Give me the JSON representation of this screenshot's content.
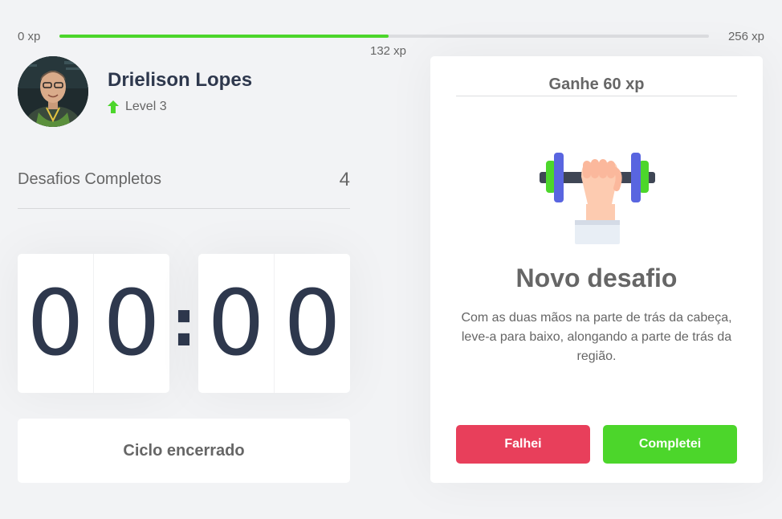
{
  "xp": {
    "min_label": "0 xp",
    "max_label": "256 xp",
    "current_label": "132 xp",
    "progress_fraction": 0.506
  },
  "profile": {
    "name": "Drielison Lopes",
    "level_label": "Level 3"
  },
  "completed": {
    "label": "Desafios Completos",
    "count": "4"
  },
  "countdown": {
    "minute_left": "0",
    "minute_right": "0",
    "separator": ":",
    "second_left": "0",
    "second_right": "0"
  },
  "cycle_button": {
    "label": "Ciclo encerrado"
  },
  "challenge": {
    "header": "Ganhe 60 xp",
    "title": "Novo desafio",
    "description": "Com as duas mãos na parte de trás da cabeça, leve-a para baixo, alongando a parte de trás da região.",
    "icon": "dumbbell-icon",
    "fail_label": "Falhei",
    "done_label": "Completei"
  },
  "colors": {
    "accent_green": "#4cd62b",
    "fail_red": "#e83f5b",
    "title_dark": "#2e384d",
    "text_gray": "#666666"
  }
}
